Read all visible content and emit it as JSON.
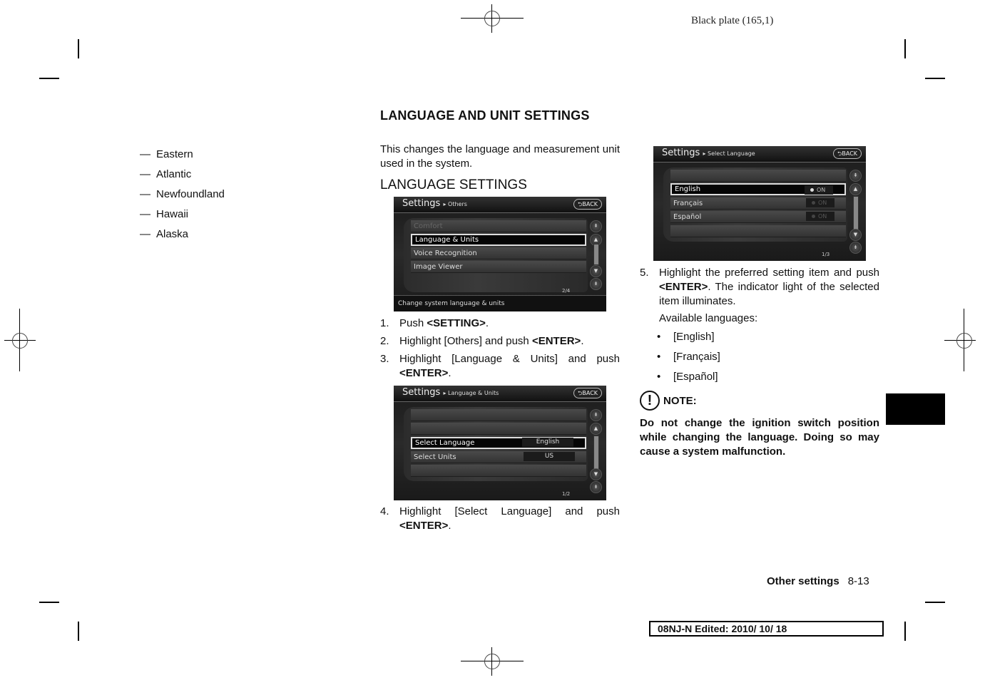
{
  "header": {
    "plate": "Black plate (165,1)"
  },
  "left_column": {
    "items": [
      "Eastern",
      "Atlantic",
      "Newfoundland",
      "Hawaii",
      "Alaska"
    ],
    "dash": "—"
  },
  "section": {
    "title": "LANGUAGE AND UNIT SETTINGS",
    "intro": "This changes the language and measurement unit used in the system.",
    "subtitle": "LANGUAGE SETTINGS"
  },
  "screens": {
    "others": {
      "title": "Settings",
      "crumb": "▸ Others",
      "back": "BACK",
      "rows": [
        "Comfort",
        "Language & Units",
        "Voice Recognition",
        "Image Viewer"
      ],
      "selected": "Language & Units",
      "page": "2/4",
      "status": "Change system language & units"
    },
    "language_units": {
      "title": "Settings",
      "crumb": "▸ Language & Units",
      "back": "BACK",
      "rows": [
        {
          "label": "Select Language",
          "value": "English"
        },
        {
          "label": "Select Units",
          "value": "US"
        }
      ],
      "page": "1/2"
    },
    "select_language": {
      "title": "Settings",
      "crumb": "▸ Select Language",
      "back": "BACK",
      "rows": [
        {
          "label": "English",
          "indicator": "ON",
          "active": true
        },
        {
          "label": "Français",
          "indicator": "ON",
          "active": false
        },
        {
          "label": "Español",
          "indicator": "ON",
          "active": false
        }
      ],
      "page": "1/3"
    }
  },
  "steps": [
    {
      "num": "1.",
      "pre": "Push ",
      "bold": "<SETTING>",
      "post": "."
    },
    {
      "num": "2.",
      "pre": "Highlight [Others] and push ",
      "bold": "<ENTER>",
      "post": "."
    },
    {
      "num": "3.",
      "pre": "Highlight [Language & Units] and push ",
      "bold": "<ENTER>",
      "post": "."
    },
    {
      "num": "4.",
      "pre": "Highlight [Select Language] and push ",
      "bold": "<ENTER>",
      "post": "."
    },
    {
      "num": "5.",
      "pre": "Highlight the preferred setting item and push ",
      "bold": "<ENTER>",
      "post": ". The indicator light of the selected item illuminates."
    }
  ],
  "available": {
    "label": "Available languages:",
    "items": [
      "[English]",
      "[Français]",
      "[Español]"
    ]
  },
  "note": {
    "label": "NOTE:",
    "icon": "!",
    "body": "Do not change the ignition switch position while changing the language. Doing so may cause a system malfunction."
  },
  "footer": {
    "section": "Other settings",
    "page": "8-13",
    "edited": "08NJ-N Edited:  2010/ 10/ 18"
  }
}
